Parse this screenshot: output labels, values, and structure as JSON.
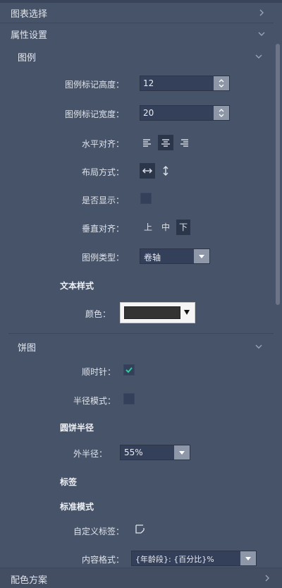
{
  "sections": {
    "chart_select": "图表选择",
    "property_settings": "属性设置",
    "color_scheme": "配色方案"
  },
  "legend": {
    "title": "图例",
    "marker_height_label": "图例标记高度：",
    "marker_height_value": "12",
    "marker_width_label": "图例标记宽度：",
    "marker_width_value": "20",
    "h_align_label": "水平对齐：",
    "layout_label": "布局方式：",
    "show_label": "是否显示：",
    "v_align_label": "垂直对齐：",
    "v_align_options": [
      "上",
      "中",
      "下"
    ],
    "type_label": "图例类型：",
    "type_value": "卷轴",
    "text_style": "文本样式",
    "color_label": "颜色：",
    "color_value": "#333333"
  },
  "pie": {
    "title": "饼图",
    "clockwise_label": "顺时针：",
    "radius_mode_label": "半径模式：",
    "radius_section": "圆饼半径",
    "outer_radius_label": "外半径：",
    "outer_radius_value": "55%",
    "tag_section": "标签",
    "standard_mode": "标准模式",
    "custom_label": "自定义标签：",
    "content_format_label": "内容格式：",
    "content_format_value": "{年龄段}: {百分比}%"
  },
  "colors": {
    "background": "#475368",
    "input": "#34405a",
    "accent_check": "#2ecc9a"
  }
}
